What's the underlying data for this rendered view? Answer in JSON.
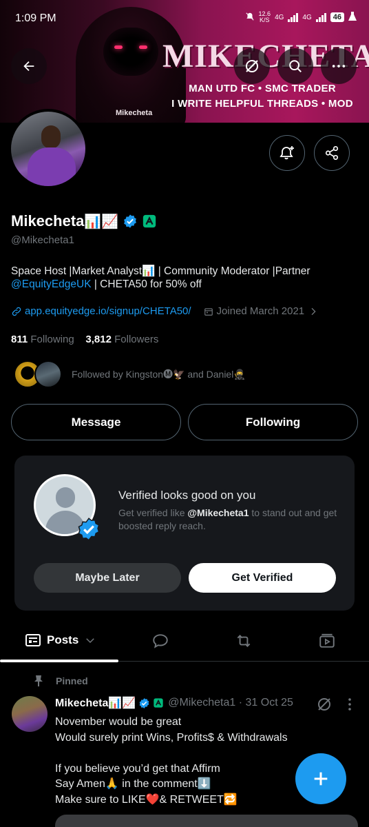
{
  "status_bar": {
    "time": "1:09 PM",
    "speed": "12.6",
    "speed_unit": "K/S",
    "net1": "4G",
    "net2": "4G",
    "battery": "46"
  },
  "banner": {
    "title": "MIKECHETA",
    "line1": "MAN UTD FC • SMC TRADER",
    "line2": "I WRITE HELPFUL THREADS • MOD",
    "signature": "Mikecheta"
  },
  "profile": {
    "display_name": "Mikecheta",
    "name_emojis": "📊📈",
    "handle": "@Mikecheta1",
    "bio_text": "Space Host |Market Analyst📊 | Community Moderator |Partner",
    "bio_mention": "@EquityEdgeUK",
    "bio_suffix": " | CHETA50 for 50% off",
    "link": "app.equityedge.io/signup/CHETA50/",
    "joined": "Joined March 2021",
    "following_count": "811",
    "following_label": "Following",
    "followers_count": "3,812",
    "followers_label": "Followers",
    "followed_by": "Followed by Kingston🅜🦅 and Daniel🥷"
  },
  "actions": {
    "message": "Message",
    "following": "Following"
  },
  "verify_card": {
    "title": "Verified looks good on you",
    "desc_prefix": "Get verified like ",
    "desc_handle": "@Mikecheta1",
    "desc_suffix": " to stand out and get boosted reply reach.",
    "maybe_later": "Maybe Later",
    "get_verified": "Get Verified"
  },
  "tabs": {
    "posts": "Posts"
  },
  "tweet": {
    "pinned_label": "Pinned",
    "author": "Mikecheta📊📈",
    "handle_time": "@Mikecheta1 · 31 Oct 25",
    "body": "November would be great\nWould surely print Wins, Profits$ & Withdrawals\n\nIf you believe you’d get that Affirm\nSay Amen🙏 in the comment⬇️\nMake sure to LIKE❤️& RETWEET🔁"
  },
  "colors": {
    "accent": "#1d9bf0",
    "background": "#000000",
    "muted": "#71767b",
    "card": "#16181c",
    "verified_green": "#00ba7c"
  },
  "icons": [
    "back-arrow-icon",
    "grok-icon",
    "search-icon",
    "more-icon",
    "bell-plus-icon",
    "share-icon",
    "verified-icon",
    "link-icon",
    "calendar-icon",
    "chevron-right-icon",
    "pin-icon",
    "reply-icon",
    "repost-icon",
    "media-icon",
    "plus-icon"
  ]
}
